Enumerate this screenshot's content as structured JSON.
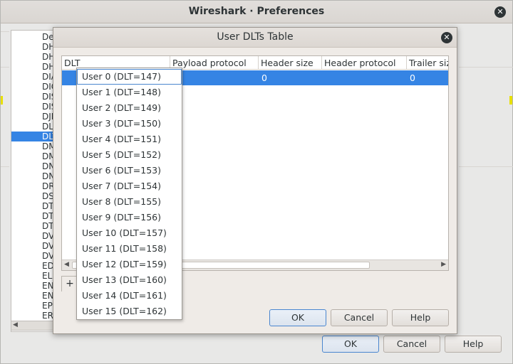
{
  "prefs_window": {
    "title": "Wireshark · Preferences",
    "tree_items": [
      "De",
      "DH",
      "DH",
      "DH",
      "DIA",
      "DIC",
      "DIS",
      "DIS",
      "DJI",
      "DL",
      "DLT",
      "DM",
      "DM",
      "DN",
      "DN",
      "DR",
      "DS",
      "DT",
      "DT",
      "DT",
      "DV",
      "DV",
      "DV",
      "ED",
      "ELF",
      "EN",
      "EN",
      "EP",
      "ER"
    ],
    "tree_selected_index": 10,
    "buttons": {
      "ok": "OK",
      "cancel": "Cancel",
      "help": "Help"
    }
  },
  "dlt_dialog": {
    "title": "User DLTs Table",
    "columns": [
      "DLT",
      "Payload protocol",
      "Header size",
      "Header protocol",
      "Trailer size"
    ],
    "rows": [
      {
        "dlt": "",
        "payload_protocol": "",
        "header_size": "0",
        "header_protocol": "",
        "trailer_size": "0"
      }
    ],
    "add_button": "+",
    "buttons": {
      "ok": "OK",
      "cancel": "Cancel",
      "help": "Help"
    }
  },
  "dlt_dropdown": {
    "selected_index": 0,
    "options": [
      "User 0 (DLT=147)",
      "User 1 (DLT=148)",
      "User 2 (DLT=149)",
      "User 3 (DLT=150)",
      "User 4 (DLT=151)",
      "User 5 (DLT=152)",
      "User 6 (DLT=153)",
      "User 7 (DLT=154)",
      "User 8 (DLT=155)",
      "User 9 (DLT=156)",
      "User 10 (DLT=157)",
      "User 11 (DLT=158)",
      "User 12 (DLT=159)",
      "User 13 (DLT=160)",
      "User 14 (DLT=161)",
      "User 15 (DLT=162)"
    ]
  },
  "colors": {
    "selection": "#3584e4",
    "default_button_border": "#4a86cf",
    "accent_yellow": "#e8e000"
  },
  "icons": {
    "close": "close-icon",
    "add": "plus-icon",
    "scroll_left": "triangle-left-icon",
    "scroll_right": "triangle-right-icon"
  }
}
